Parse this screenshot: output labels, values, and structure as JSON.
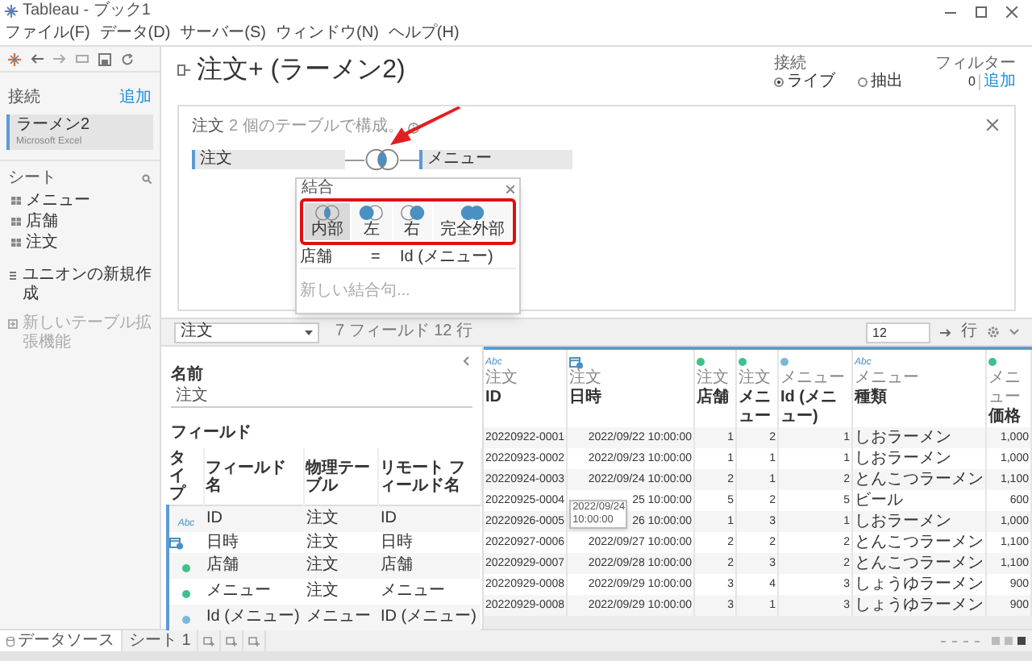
{
  "window": {
    "title": "Tableau - ブック1"
  },
  "menu": [
    "ファイル(F)",
    "データ(D)",
    "サーバー(S)",
    "ウィンドウ(N)",
    "ヘルプ(H)"
  ],
  "sidebar": {
    "connections_heading": "接続",
    "add_link": "追加",
    "connections": [
      {
        "name": "ラーメン2",
        "type": "Microsoft Excel",
        "selected": true
      }
    ],
    "sheets_heading": "シート",
    "sheets": [
      "メニュー",
      "店舗",
      "注文"
    ],
    "actions": [
      {
        "kind": "union",
        "label": "ユニオンの新規作成",
        "disabled": false
      },
      {
        "kind": "extension",
        "label": "新しいテーブル拡張機能",
        "disabled": true
      }
    ]
  },
  "header": {
    "title": "注文+ (ラーメン2)",
    "connection_label": "接続",
    "connection_modes": [
      {
        "label": "ライブ",
        "selected": true
      },
      {
        "label": "抽出",
        "selected": false
      }
    ],
    "filters_label": "フィルター",
    "filter_count": "0",
    "filter_add": "追加"
  },
  "canvas": {
    "table": "注文",
    "summary": "2 個のテーブルで構成。",
    "left_table": "注文",
    "right_table": "メニュー"
  },
  "join_dialog": {
    "title": "結合",
    "types": [
      {
        "kind": "inner",
        "label": "内部",
        "selected": true
      },
      {
        "kind": "left",
        "label": "左",
        "selected": false
      },
      {
        "kind": "right",
        "label": "右",
        "selected": false
      },
      {
        "kind": "full",
        "label": "完全外部",
        "selected": false
      }
    ],
    "conditions": [
      {
        "left": "店舗",
        "operator": "=",
        "right": "Id (メニュー)"
      }
    ],
    "new_clause_placeholder": "新しい結合句..."
  },
  "toolbar": {
    "table_select": "注文",
    "summary": "7 フィールド 12 行",
    "row_count": "12",
    "rows_label": "行"
  },
  "details": {
    "name_label": "名前",
    "name_value": "注文",
    "fields_label": "フィールド",
    "columns": [
      "タイプ",
      "フィールド名",
      "物理テーブル",
      "リモート フィールド名"
    ],
    "fields": [
      {
        "kind": "string",
        "icon_text": "Abc",
        "name": "ID",
        "table": "注文",
        "remote": "ID"
      },
      {
        "kind": "datetime",
        "name": "日時",
        "table": "注文",
        "remote": "日時"
      },
      {
        "kind": "number",
        "color": "#3cc28a",
        "name": "店舗",
        "table": "注文",
        "remote": "店舗"
      },
      {
        "kind": "number",
        "color": "#3cc28a",
        "name": "メニュー",
        "table": "注文",
        "remote": "メニュー"
      },
      {
        "kind": "number",
        "color": "#7ab8d8",
        "name": "Id (メニュー)",
        "table": "メニュー",
        "remote": "ID (メニュー)"
      }
    ]
  },
  "grid": {
    "columns": [
      {
        "kind": "string",
        "icon_text": "Abc",
        "table": "注文",
        "name": "ID"
      },
      {
        "kind": "datetime",
        "table": "注文",
        "name": "日時"
      },
      {
        "kind": "number",
        "color": "#3cc28a",
        "table": "注文",
        "name": "店舗"
      },
      {
        "kind": "number",
        "color": "#3cc28a",
        "table": "注文",
        "name": "メニュー"
      },
      {
        "kind": "number",
        "color": "#7ab8d8",
        "table": "メニュー",
        "name": "Id (メニュー)"
      },
      {
        "kind": "string",
        "icon_text": "Abc",
        "table": "メニュー",
        "name": "種類"
      },
      {
        "kind": "number",
        "color": "#3cc28a",
        "table": "メニュー",
        "name": "価格"
      }
    ],
    "rows": [
      [
        "20220922-0001",
        "2022/09/22 10:00:00",
        "1",
        "2",
        "1",
        "しおラーメン",
        "1,000"
      ],
      [
        "20220923-0002",
        "2022/09/23 10:00:00",
        "1",
        "1",
        "1",
        "しおラーメン",
        "1,000"
      ],
      [
        "20220924-0003",
        "2022/09/24 10:00:00",
        "2",
        "1",
        "2",
        "とんこつラーメン",
        "1,100"
      ],
      [
        "20220925-0004",
        "25 10:00:00",
        "5",
        "2",
        "5",
        "ビール",
        "600"
      ],
      [
        "20220926-0005",
        "26 10:00:00",
        "1",
        "3",
        "1",
        "しおラーメン",
        "1,000"
      ],
      [
        "20220927-0006",
        "2022/09/27 10:00:00",
        "2",
        "2",
        "2",
        "とんこつラーメン",
        "1,100"
      ],
      [
        "20220929-0007",
        "2022/09/28 10:00:00",
        "2",
        "3",
        "2",
        "とんこつラーメン",
        "1,100"
      ],
      [
        "20220929-0008",
        "2022/09/29 10:00:00",
        "3",
        "4",
        "3",
        "しょうゆラーメン",
        "900"
      ],
      [
        "20220929-0008",
        "2022/09/29 10:00:00",
        "3",
        "1",
        "3",
        "しょうゆラーメン",
        "900"
      ]
    ],
    "tooltip": "2022/09/24 10:00:00"
  },
  "footer": {
    "tabs": [
      {
        "label": "データソース",
        "selected": true
      },
      {
        "label": "シート 1",
        "selected": false
      }
    ]
  }
}
